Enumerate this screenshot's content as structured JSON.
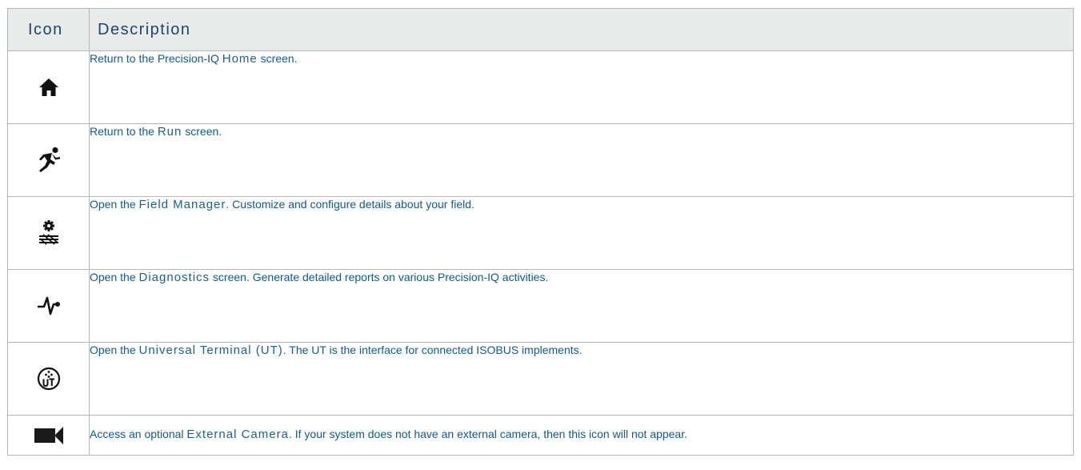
{
  "table": {
    "headers": {
      "icon": "Icon",
      "description": "Description"
    },
    "rows": [
      {
        "icon": "home-icon",
        "before": "Return to the Precision-IQ ",
        "ui": "Home",
        "after": " screen."
      },
      {
        "icon": "run-icon",
        "before": "Return to the ",
        "ui": "Run",
        "after": " screen."
      },
      {
        "icon": "field-manager-icon",
        "before": "Open the ",
        "ui": "Field Manager",
        "after": ". Customize and configure details about your field."
      },
      {
        "icon": "diagnostics-icon",
        "before": "Open the ",
        "ui": "Diagnostics",
        "after": " screen. Generate detailed reports on various Precision-IQ activities."
      },
      {
        "icon": "universal-terminal-icon",
        "before": "Open the ",
        "ui": "Universal Terminal (UT)",
        "after": ". The UT is the interface for connected ISOBUS implements."
      },
      {
        "icon": "external-camera-icon",
        "before": "Access an optional ",
        "ui": "External Camera",
        "after": ". If your system does not have an external camera, then this icon will not appear."
      }
    ]
  }
}
